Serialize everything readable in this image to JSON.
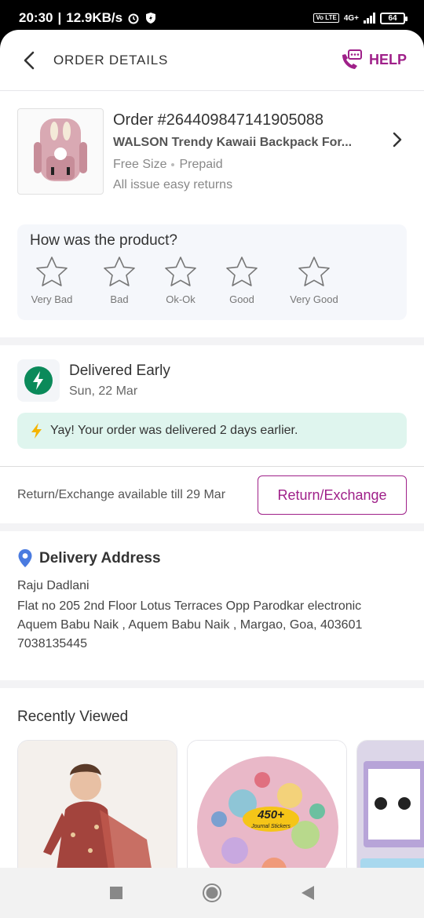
{
  "status_bar": {
    "time": "20:30",
    "speed": "12.9KB/s",
    "network": "4G+",
    "volte": "Vo LTE",
    "battery": "64"
  },
  "header": {
    "title": "ORDER DETAILS",
    "help_label": "HELP"
  },
  "product": {
    "order_id": "Order #264409847141905088",
    "name": "WALSON Trendy Kawaii Backpack For...",
    "size": "Free Size",
    "payment": "Prepaid",
    "returns_note": "All issue easy returns"
  },
  "rating": {
    "question": "How was the product?",
    "options": [
      "Very Bad",
      "Bad",
      "Ok-Ok",
      "Good",
      "Very Good"
    ]
  },
  "delivery": {
    "status": "Delivered Early",
    "date": "Sun, 22 Mar",
    "message": "Yay! Your order was delivered 2 days earlier."
  },
  "return": {
    "availability": "Return/Exchange available till 29 Mar",
    "button_label": "Return/Exchange"
  },
  "address": {
    "title": "Delivery Address",
    "name": "Raju Dadlani",
    "line1": "Flat no 205 2nd Floor Lotus Terraces Opp Parodkar electronic",
    "line2": "Aquem Babu Naik , Aquem Babu Naik , Margao, Goa, 403601",
    "phone": "7038135445"
  },
  "recently_viewed": {
    "title": "Recently Viewed",
    "sticker_badge": "450+",
    "sticker_caption": "Journal Stickers"
  },
  "colors": {
    "brand": "#9f2089",
    "success_bg": "#dff5ee",
    "success_icon": "#0b8a5a",
    "location_pin": "#4a7be0"
  }
}
